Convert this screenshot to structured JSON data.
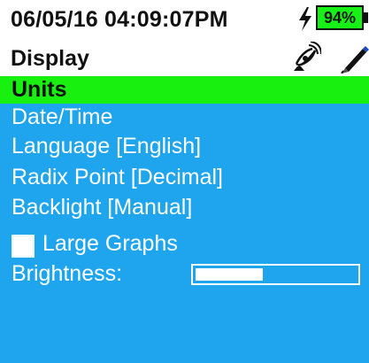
{
  "status_bar": {
    "datetime": "06/05/16  04:09:07PM",
    "battery_percent": "94%",
    "icons": {
      "charging": "lightning-bolt-icon",
      "gps": "satellite-dish-icon",
      "tool": "pen-icon"
    }
  },
  "title_bar": {
    "title": "Display"
  },
  "menu": {
    "items": [
      {
        "label": "Units",
        "selected": true
      },
      {
        "label": "Date/Time",
        "selected": false
      },
      {
        "label": "Language [English]",
        "selected": false
      },
      {
        "label": "Radix Point [Decimal]",
        "selected": false
      },
      {
        "label": "Backlight [Manual]",
        "selected": false
      }
    ],
    "large_graphs": {
      "label": "Large Graphs",
      "checked": false
    },
    "brightness": {
      "label": "Brightness:",
      "level": 0.42
    }
  },
  "colors": {
    "menu_background": "#1ea5ee",
    "selected_background": "#18f10f",
    "battery_fill": "#16f216"
  }
}
